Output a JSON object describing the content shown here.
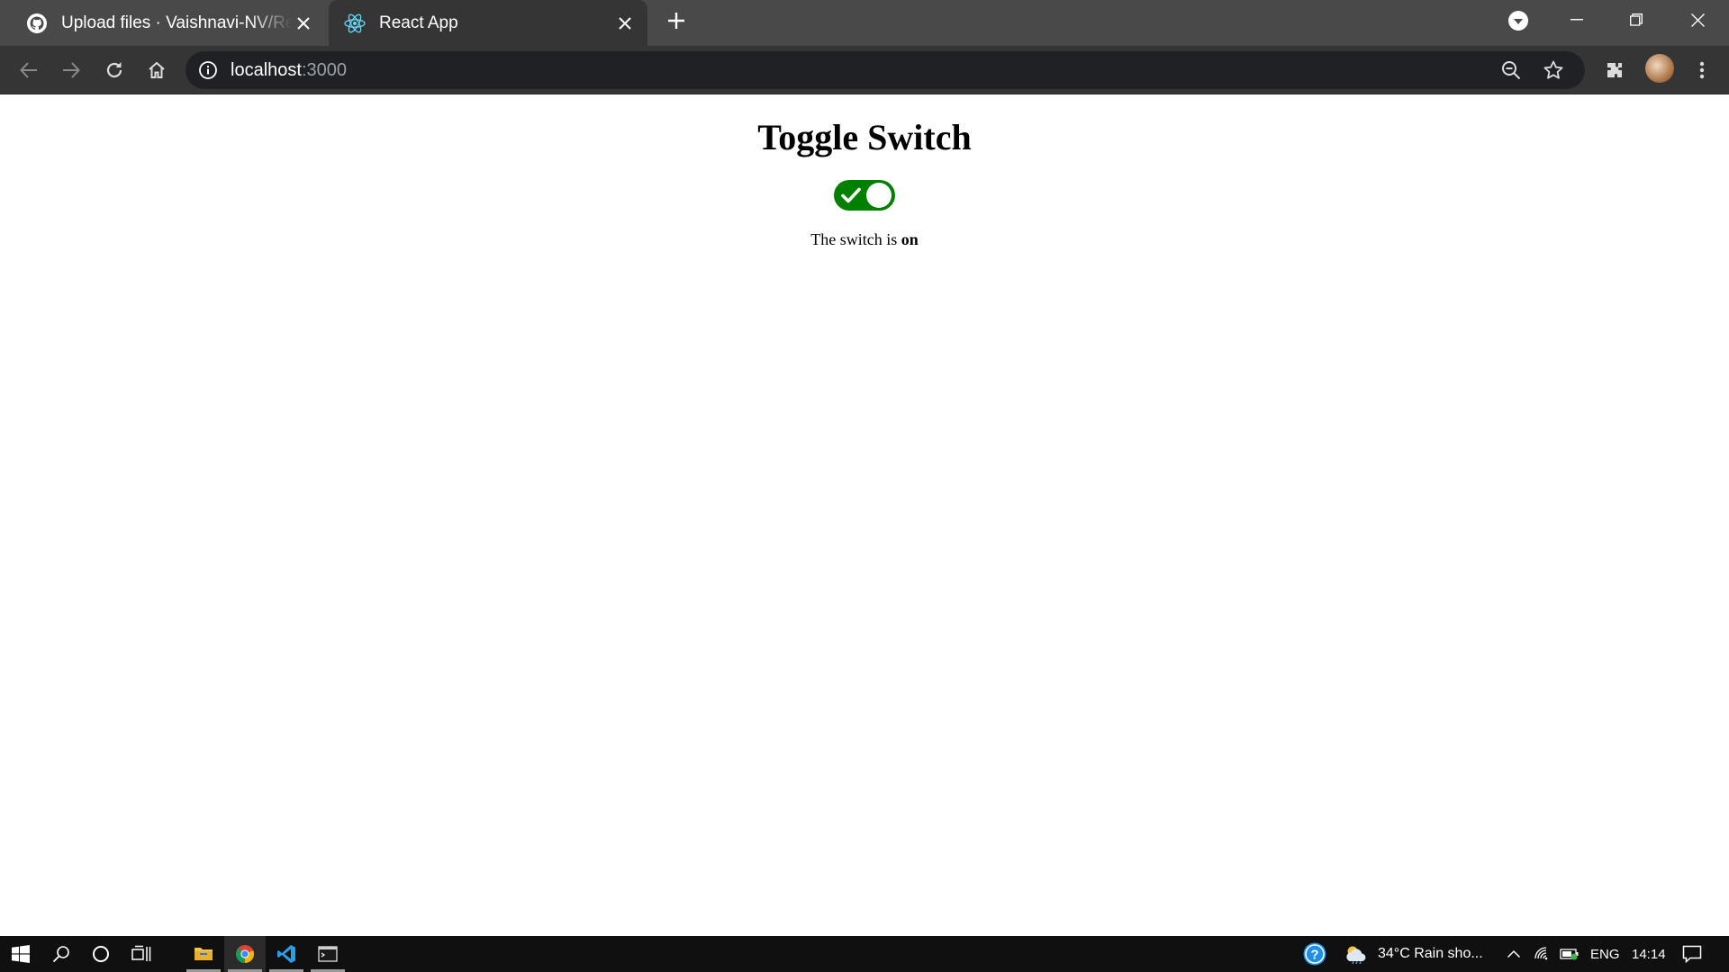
{
  "browser": {
    "tabs": [
      {
        "title": "Upload files · Vaishnavi-NV/React",
        "favicon": "github-icon",
        "active": false
      },
      {
        "title": "React App",
        "favicon": "react-icon",
        "active": true
      }
    ],
    "address": {
      "host": "localhost",
      "port": ":3000"
    }
  },
  "page": {
    "heading": "Toggle Switch",
    "switch": {
      "state": "on",
      "on_color": "#008000"
    },
    "status_prefix": "The switch is",
    "status_value": "on"
  },
  "taskbar": {
    "weather": "34°C  Rain sho...",
    "language": "ENG",
    "time": "14:14"
  }
}
